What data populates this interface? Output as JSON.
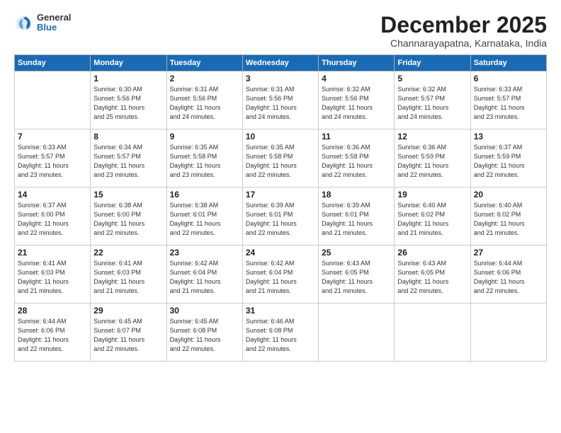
{
  "logo": {
    "general": "General",
    "blue": "Blue"
  },
  "title": {
    "month": "December 2025",
    "location": "Channarayapatna, Karnataka, India"
  },
  "weekdays": [
    "Sunday",
    "Monday",
    "Tuesday",
    "Wednesday",
    "Thursday",
    "Friday",
    "Saturday"
  ],
  "weeks": [
    [
      {
        "day": "",
        "info": ""
      },
      {
        "day": "1",
        "info": "Sunrise: 6:30 AM\nSunset: 5:56 PM\nDaylight: 11 hours\nand 25 minutes."
      },
      {
        "day": "2",
        "info": "Sunrise: 6:31 AM\nSunset: 5:56 PM\nDaylight: 11 hours\nand 24 minutes."
      },
      {
        "day": "3",
        "info": "Sunrise: 6:31 AM\nSunset: 5:56 PM\nDaylight: 11 hours\nand 24 minutes."
      },
      {
        "day": "4",
        "info": "Sunrise: 6:32 AM\nSunset: 5:56 PM\nDaylight: 11 hours\nand 24 minutes."
      },
      {
        "day": "5",
        "info": "Sunrise: 6:32 AM\nSunset: 5:57 PM\nDaylight: 11 hours\nand 24 minutes."
      },
      {
        "day": "6",
        "info": "Sunrise: 6:33 AM\nSunset: 5:57 PM\nDaylight: 11 hours\nand 23 minutes."
      }
    ],
    [
      {
        "day": "7",
        "info": "Sunrise: 6:33 AM\nSunset: 5:57 PM\nDaylight: 11 hours\nand 23 minutes."
      },
      {
        "day": "8",
        "info": "Sunrise: 6:34 AM\nSunset: 5:57 PM\nDaylight: 11 hours\nand 23 minutes."
      },
      {
        "day": "9",
        "info": "Sunrise: 6:35 AM\nSunset: 5:58 PM\nDaylight: 11 hours\nand 23 minutes."
      },
      {
        "day": "10",
        "info": "Sunrise: 6:35 AM\nSunset: 5:58 PM\nDaylight: 11 hours\nand 22 minutes."
      },
      {
        "day": "11",
        "info": "Sunrise: 6:36 AM\nSunset: 5:58 PM\nDaylight: 11 hours\nand 22 minutes."
      },
      {
        "day": "12",
        "info": "Sunrise: 6:36 AM\nSunset: 5:59 PM\nDaylight: 11 hours\nand 22 minutes."
      },
      {
        "day": "13",
        "info": "Sunrise: 6:37 AM\nSunset: 5:59 PM\nDaylight: 11 hours\nand 22 minutes."
      }
    ],
    [
      {
        "day": "14",
        "info": "Sunrise: 6:37 AM\nSunset: 6:00 PM\nDaylight: 11 hours\nand 22 minutes."
      },
      {
        "day": "15",
        "info": "Sunrise: 6:38 AM\nSunset: 6:00 PM\nDaylight: 11 hours\nand 22 minutes."
      },
      {
        "day": "16",
        "info": "Sunrise: 6:38 AM\nSunset: 6:01 PM\nDaylight: 11 hours\nand 22 minutes."
      },
      {
        "day": "17",
        "info": "Sunrise: 6:39 AM\nSunset: 6:01 PM\nDaylight: 11 hours\nand 22 minutes."
      },
      {
        "day": "18",
        "info": "Sunrise: 6:39 AM\nSunset: 6:01 PM\nDaylight: 11 hours\nand 21 minutes."
      },
      {
        "day": "19",
        "info": "Sunrise: 6:40 AM\nSunset: 6:02 PM\nDaylight: 11 hours\nand 21 minutes."
      },
      {
        "day": "20",
        "info": "Sunrise: 6:40 AM\nSunset: 6:02 PM\nDaylight: 11 hours\nand 21 minutes."
      }
    ],
    [
      {
        "day": "21",
        "info": "Sunrise: 6:41 AM\nSunset: 6:03 PM\nDaylight: 11 hours\nand 21 minutes."
      },
      {
        "day": "22",
        "info": "Sunrise: 6:41 AM\nSunset: 6:03 PM\nDaylight: 11 hours\nand 21 minutes."
      },
      {
        "day": "23",
        "info": "Sunrise: 6:42 AM\nSunset: 6:04 PM\nDaylight: 11 hours\nand 21 minutes."
      },
      {
        "day": "24",
        "info": "Sunrise: 6:42 AM\nSunset: 6:04 PM\nDaylight: 11 hours\nand 21 minutes."
      },
      {
        "day": "25",
        "info": "Sunrise: 6:43 AM\nSunset: 6:05 PM\nDaylight: 11 hours\nand 21 minutes."
      },
      {
        "day": "26",
        "info": "Sunrise: 6:43 AM\nSunset: 6:05 PM\nDaylight: 11 hours\nand 22 minutes."
      },
      {
        "day": "27",
        "info": "Sunrise: 6:44 AM\nSunset: 6:06 PM\nDaylight: 11 hours\nand 22 minutes."
      }
    ],
    [
      {
        "day": "28",
        "info": "Sunrise: 6:44 AM\nSunset: 6:06 PM\nDaylight: 11 hours\nand 22 minutes."
      },
      {
        "day": "29",
        "info": "Sunrise: 6:45 AM\nSunset: 6:07 PM\nDaylight: 11 hours\nand 22 minutes."
      },
      {
        "day": "30",
        "info": "Sunrise: 6:45 AM\nSunset: 6:08 PM\nDaylight: 11 hours\nand 22 minutes."
      },
      {
        "day": "31",
        "info": "Sunrise: 6:46 AM\nSunset: 6:08 PM\nDaylight: 11 hours\nand 22 minutes."
      },
      {
        "day": "",
        "info": ""
      },
      {
        "day": "",
        "info": ""
      },
      {
        "day": "",
        "info": ""
      }
    ]
  ]
}
